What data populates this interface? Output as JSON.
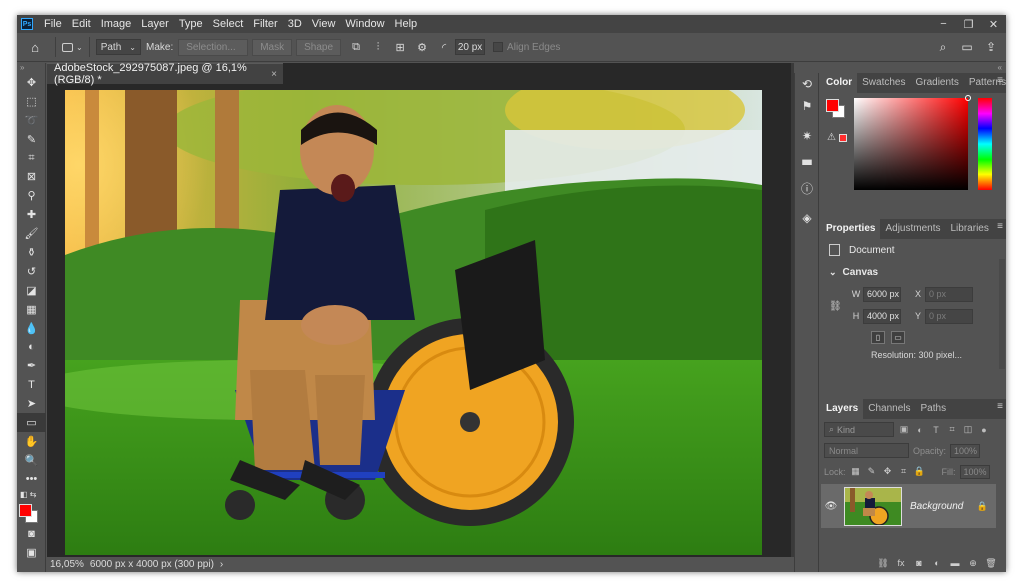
{
  "app": {
    "logo_text": "Ps",
    "menu": [
      "File",
      "Edit",
      "Image",
      "Layer",
      "Type",
      "Select",
      "Filter",
      "3D",
      "View",
      "Window",
      "Help"
    ],
    "window_controls": [
      "−",
      "❐",
      "✕"
    ]
  },
  "options_bar": {
    "mode_value": "Path",
    "make_label": "Make:",
    "selection_label": "Selection...",
    "mask_label": "Mask",
    "shape_label": "Shape",
    "radius_value": "20 px",
    "align_edges_label": "Align Edges"
  },
  "document": {
    "tab_title": "AdobeStock_292975087.jpeg @ 16,1% (RGB/8) *",
    "tab_close": "×"
  },
  "status_bar": {
    "zoom": "16,05%",
    "doc_info": "6000 px x 4000 px (300 ppi)",
    "arrow": "›"
  },
  "tools": [
    {
      "name": "move-tool",
      "glyph": "✥"
    },
    {
      "name": "marquee-tool",
      "glyph": "⬚"
    },
    {
      "name": "lasso-tool",
      "glyph": "➰"
    },
    {
      "name": "quick-select-tool",
      "glyph": "✎"
    },
    {
      "name": "crop-tool",
      "glyph": "⌗"
    },
    {
      "name": "frame-tool",
      "glyph": "⊠"
    },
    {
      "name": "eyedropper-tool",
      "glyph": "⚲"
    },
    {
      "name": "healing-brush-tool",
      "glyph": "✚"
    },
    {
      "name": "brush-tool",
      "glyph": "🖌"
    },
    {
      "name": "clone-stamp-tool",
      "glyph": "⚱"
    },
    {
      "name": "history-brush-tool",
      "glyph": "↺"
    },
    {
      "name": "eraser-tool",
      "glyph": "◪"
    },
    {
      "name": "gradient-tool",
      "glyph": "▦"
    },
    {
      "name": "blur-tool",
      "glyph": "💧"
    },
    {
      "name": "dodge-tool",
      "glyph": "◐"
    },
    {
      "name": "pen-tool",
      "glyph": "✒"
    },
    {
      "name": "type-tool",
      "glyph": "T"
    },
    {
      "name": "path-select-tool",
      "glyph": "➤"
    },
    {
      "name": "rectangle-tool",
      "glyph": "▭"
    },
    {
      "name": "hand-tool",
      "glyph": "✋"
    },
    {
      "name": "zoom-tool",
      "glyph": "🔍"
    },
    {
      "name": "more-tools",
      "glyph": "•••"
    }
  ],
  "panels": {
    "color_tabs": [
      "Color",
      "Swatches",
      "Gradients",
      "Patterns"
    ],
    "properties_tabs": [
      "Properties",
      "Adjustments",
      "Libraries"
    ],
    "properties_document": "Document",
    "canvas_section": "Canvas",
    "width_label": "W",
    "width_value": "6000 px",
    "height_label": "H",
    "height_value": "4000 px",
    "x_label": "X",
    "x_placeholder": "0 px",
    "y_label": "Y",
    "y_placeholder": "0 px",
    "resolution": "Resolution: 300 pixel...",
    "layers_tabs": [
      "Layers",
      "Channels",
      "Paths"
    ],
    "kind_placeholder": "Kind",
    "blend_mode": "Normal",
    "opacity_label": "Opacity:",
    "opacity_value": "100%",
    "lock_label": "Lock:",
    "fill_label": "Fill:",
    "fill_value": "100%",
    "layer_name": "Background"
  },
  "colors": {
    "foreground": "#ff0000",
    "background": "#ffffff"
  }
}
